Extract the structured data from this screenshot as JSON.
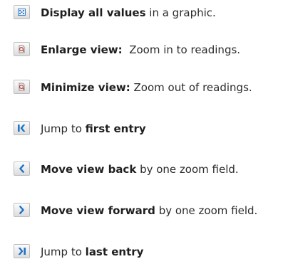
{
  "items": [
    {
      "icon": "display-all-values-icon",
      "bold": "Display all values",
      "rest": " in a graphic."
    },
    {
      "icon": "enlarge-view-icon",
      "bold": "Enlarge view:",
      "rest": "  Zoom in to readings."
    },
    {
      "icon": "minimize-view-icon",
      "bold": "Minimize view:",
      "rest": " Zoom out of readings."
    },
    {
      "icon": "jump-first-icon",
      "pre": "Jump to ",
      "bold": "first entry"
    },
    {
      "icon": "move-back-icon",
      "bold": "Move view back",
      "rest": " by one zoom field."
    },
    {
      "icon": "move-forward-icon",
      "bold": "Move view forward",
      "rest": " by one zoom field."
    },
    {
      "icon": "jump-last-icon",
      "pre": "Jump to ",
      "bold": "last entry"
    }
  ],
  "colors": {
    "icon_blue": "#1e73c8",
    "text": "#2b2b2b"
  }
}
